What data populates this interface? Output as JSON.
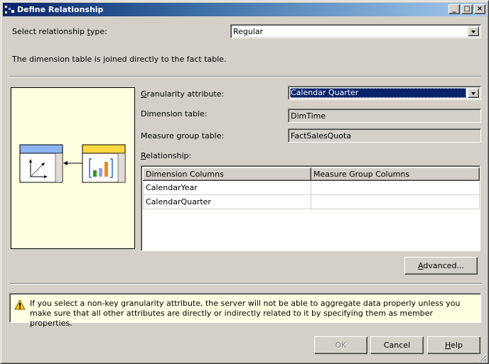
{
  "window": {
    "title": "Define Relationship",
    "controls": {
      "minimize": "_",
      "maximize": "□",
      "close": "×"
    }
  },
  "relationship_type": {
    "label_prefix": "Select relationship ",
    "label_accel": "t",
    "label_suffix": "ype:",
    "value": "Regular",
    "description": "The dimension table is joined directly to the fact table."
  },
  "diagram": {
    "dimension_icon": "dimension-table-icon",
    "measure_icon": "measure-group-icon",
    "colors": {
      "dimension_header": "#8fb4f7",
      "measure_header": "#ffd840",
      "background": "#ffffe1"
    }
  },
  "fields": {
    "granularity": {
      "label_accel": "G",
      "label_rest": "ranularity attribute:",
      "value": "Calendar Quarter"
    },
    "dimension_table": {
      "label": "Dimension table:",
      "value": "DimTime"
    },
    "measure_group_table": {
      "label": "Measure group table:",
      "value": "FactSalesQuota"
    },
    "relationship": {
      "label_accel": "R",
      "label_rest": "elationship:"
    }
  },
  "grid": {
    "columns": [
      "Dimension Columns",
      "Measure Group Columns"
    ],
    "rows": [
      [
        "CalendarYear",
        ""
      ],
      [
        "CalendarQuarter",
        ""
      ]
    ]
  },
  "advanced_button": {
    "accel": "A",
    "rest": "dvanced..."
  },
  "warning": {
    "icon": "warning-icon",
    "text": "If you select a non-key granularity attribute, the server will not be able to aggregate data properly unless you make sure that all other attributes are directly or indirectly related to it by specifying them as member properties."
  },
  "buttons": {
    "ok": "OK",
    "cancel": "Cancel",
    "help_accel": "H",
    "help_rest": "elp"
  }
}
